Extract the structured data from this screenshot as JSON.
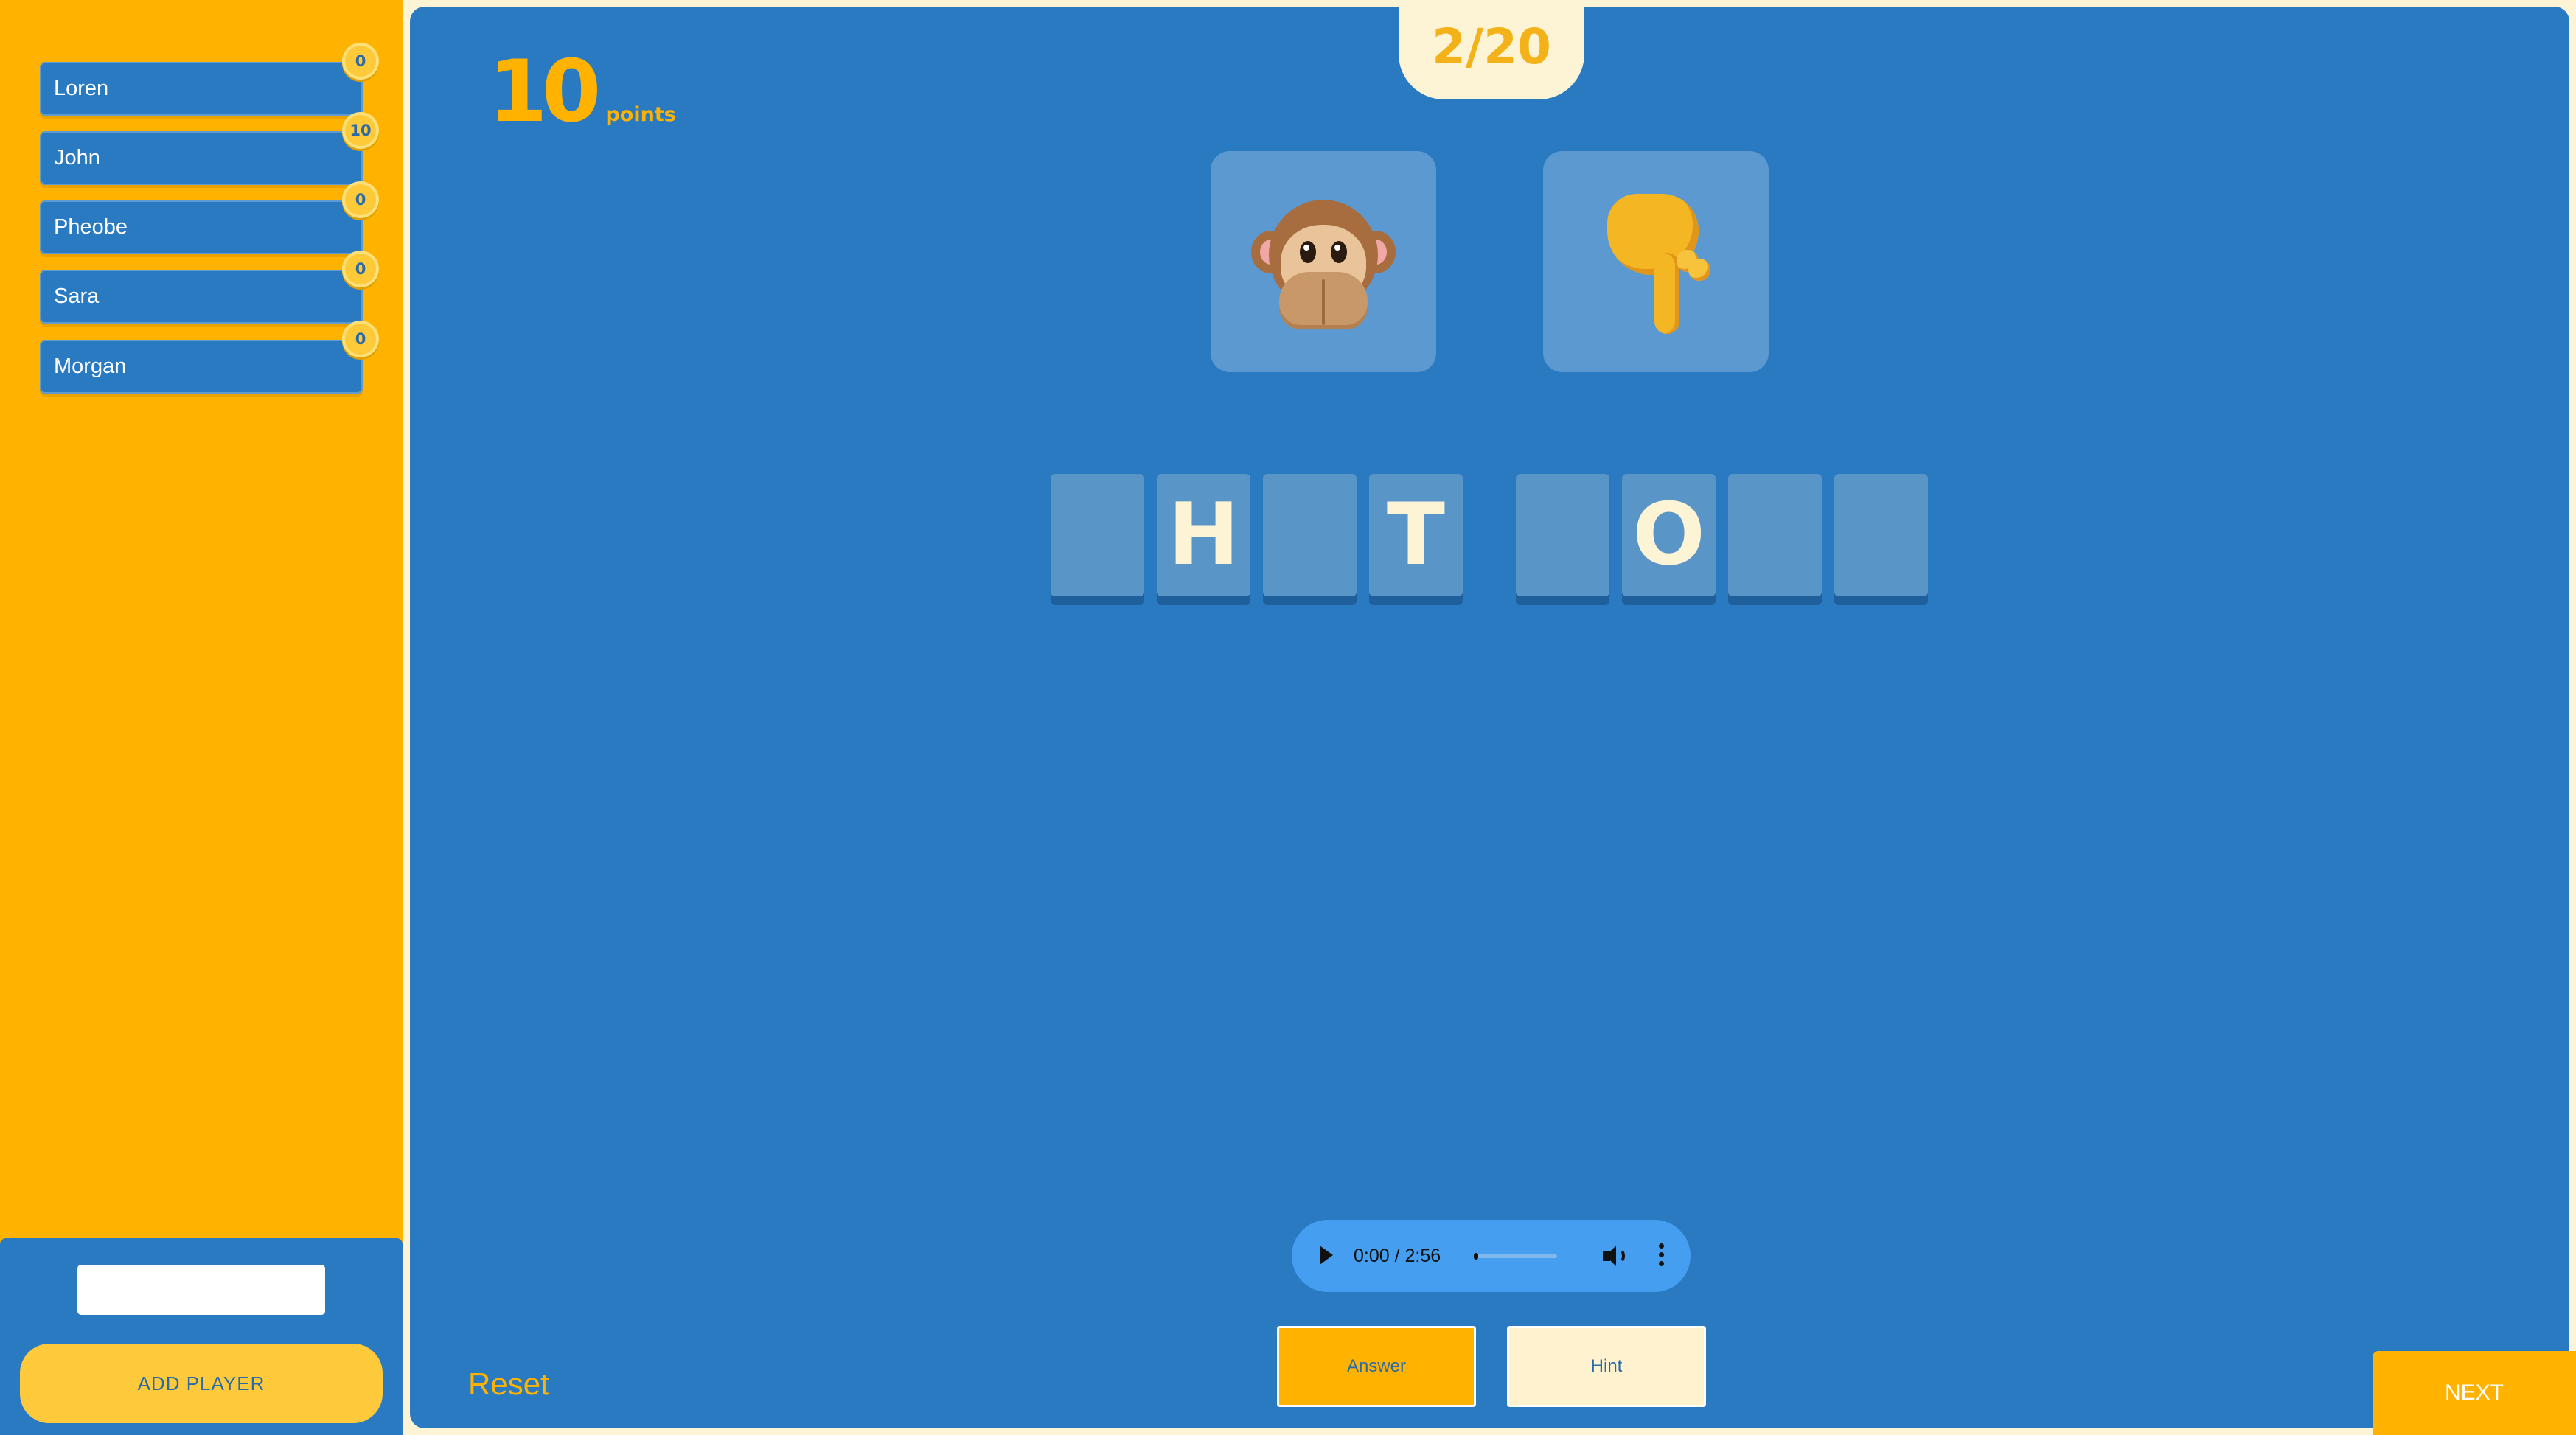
{
  "players": [
    {
      "name": "Loren",
      "score": "0"
    },
    {
      "name": "John",
      "score": "10"
    },
    {
      "name": "Pheobe",
      "score": "0"
    },
    {
      "name": "Sara",
      "score": "0"
    },
    {
      "name": "Morgan",
      "score": "0"
    }
  ],
  "add_player": {
    "input_value": "",
    "button_label": "ADD PLAYER"
  },
  "round": {
    "label": "2/20"
  },
  "points": {
    "value": "10",
    "label": "points"
  },
  "clues": [
    {
      "icon": "speak-no-evil-monkey-icon"
    },
    {
      "icon": "pointing-down-hand-icon"
    }
  ],
  "tiles": [
    "",
    "H",
    "",
    "T",
    "",
    "O",
    "",
    ""
  ],
  "audio": {
    "time": "0:00 / 2:56",
    "progress": 0
  },
  "buttons": {
    "answer": "Answer",
    "hint": "Hint",
    "reset": "Reset",
    "next": "NEXT"
  },
  "colors": {
    "sidebar": "#ffb300",
    "board": "#2a7ac2",
    "accent": "#ffb300",
    "cream": "#fdf4d6"
  }
}
